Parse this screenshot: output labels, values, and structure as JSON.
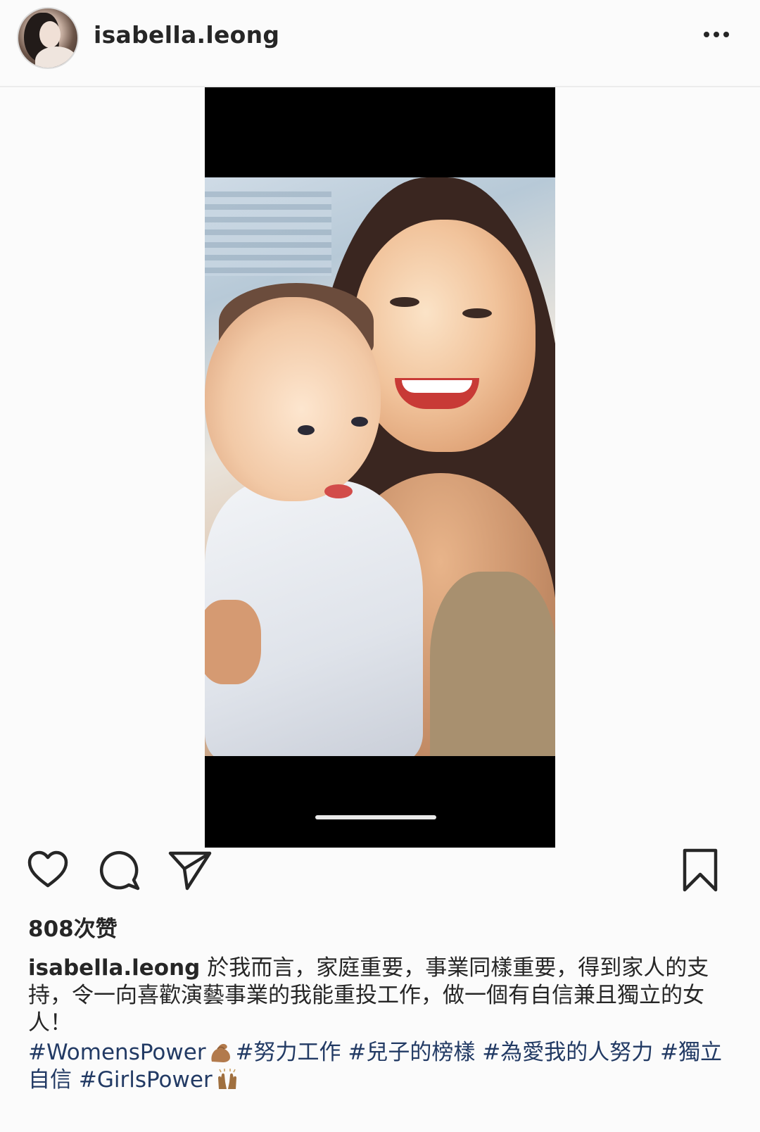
{
  "header": {
    "username": "isabella.leong",
    "more_icon": "more-horizontal-icon"
  },
  "post": {
    "likes": "808次赞",
    "caption_user": "isabella.leong",
    "caption_text": "於我而言，家庭重要，事業同樣重要，得到家人的支持，令一向喜歡演藝事業的我能重投工作，做一個有自信兼且獨立的女人！",
    "hashtags": {
      "tag1": "#WomensPower",
      "tag2": "#努力工作 #兒子的榜樣 #為愛我的人努力 #獨立自信 #GirlsPower"
    }
  },
  "icons": {
    "like": "heart-icon",
    "comment": "comment-icon",
    "share": "send-icon",
    "save": "bookmark-icon",
    "emoji1": "flexed-biceps-emoji",
    "emoji2": "raised-hands-emoji"
  },
  "colors": {
    "hashtag": "#223a64",
    "text": "#262626",
    "background": "#fbfbfb"
  }
}
